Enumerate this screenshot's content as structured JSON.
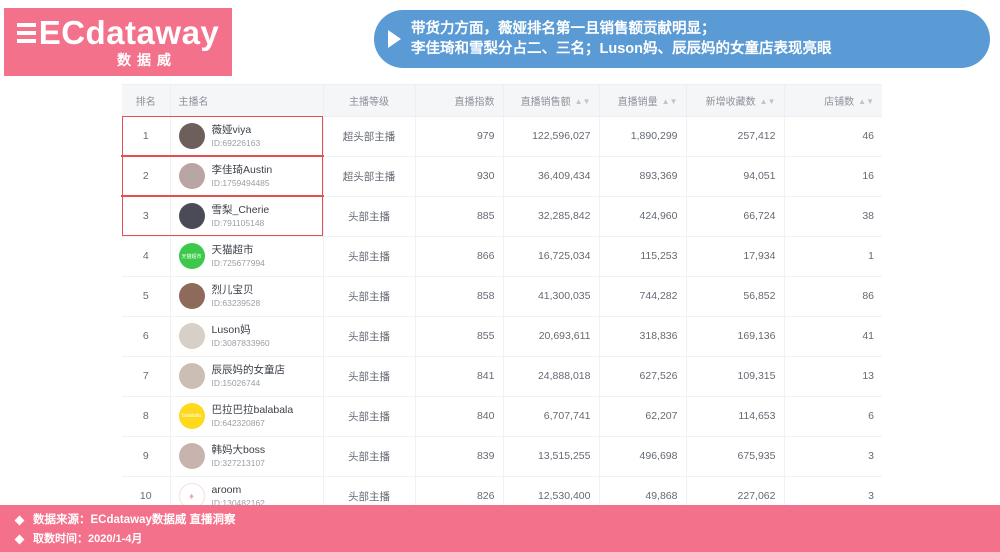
{
  "logo": {
    "name": "ECdataway",
    "sub": "数据威",
    "bars_icon": "three-bars-icon"
  },
  "banner": {
    "arrow_icon": "play-triangle-icon",
    "line1": "带货力方面，薇娅排名第一且销售额贡献明显；",
    "line2": "李佳琦和雪梨分占二、三名；Luson妈、辰辰妈的女童店表现亮眼",
    "color": "#5b9bd5"
  },
  "table": {
    "headers": {
      "rank": "排名",
      "name": "主播名",
      "level": "主播等级",
      "index": "直播指数",
      "sales": "直播销售额",
      "volume": "直播销量",
      "favorites": "新增收藏数",
      "shops": "店铺数"
    },
    "sort_icon": "sort-updown-icon",
    "id_prefix": "ID:",
    "highlight_color": "#e2504f",
    "rows": [
      {
        "rank": "1",
        "name": "薇娅viya",
        "id": "ID:69226163",
        "level": "超头部主播",
        "index": "979",
        "sales": "122,596,027",
        "volume": "1,890,299",
        "favorites": "257,412",
        "shops": "46",
        "avatar": "avatar-photo",
        "avatar_color": "#6e5f5c",
        "avatar_text": ""
      },
      {
        "rank": "2",
        "name": "李佳琦Austin",
        "id": "ID:1759494485",
        "level": "超头部主播",
        "index": "930",
        "sales": "36,409,434",
        "volume": "893,369",
        "favorites": "94,051",
        "shops": "16",
        "avatar": "avatar-photo",
        "avatar_color": "#b9a6a3",
        "avatar_text": ""
      },
      {
        "rank": "3",
        "name": "雪梨_Cherie",
        "id": "ID:791105148",
        "level": "头部主播",
        "index": "885",
        "sales": "32,285,842",
        "volume": "424,960",
        "favorites": "66,724",
        "shops": "38",
        "avatar": "avatar-photo",
        "avatar_color": "#4b4a57",
        "avatar_text": ""
      },
      {
        "rank": "4",
        "name": "天猫超市",
        "id": "ID:725677994",
        "level": "头部主播",
        "index": "866",
        "sales": "16,725,034",
        "volume": "115,253",
        "favorites": "17,934",
        "shops": "1",
        "avatar": "avatar-logo-tmall",
        "avatar_color": "#3cc84a",
        "avatar_text": "天猫超市"
      },
      {
        "rank": "5",
        "name": "烈儿宝贝",
        "id": "ID:63239528",
        "level": "头部主播",
        "index": "858",
        "sales": "41,300,035",
        "volume": "744,282",
        "favorites": "56,852",
        "shops": "86",
        "avatar": "avatar-photo",
        "avatar_color": "#8d6a5a",
        "avatar_text": ""
      },
      {
        "rank": "6",
        "name": "Luson妈",
        "id": "ID:3087833960",
        "level": "头部主播",
        "index": "855",
        "sales": "20,693,611",
        "volume": "318,836",
        "favorites": "169,136",
        "shops": "41",
        "avatar": "avatar-photo",
        "avatar_color": "#d8cfc6",
        "avatar_text": ""
      },
      {
        "rank": "7",
        "name": "辰辰妈的女童店",
        "id": "ID:15026744",
        "level": "头部主播",
        "index": "841",
        "sales": "24,888,018",
        "volume": "627,526",
        "favorites": "109,315",
        "shops": "13",
        "avatar": "avatar-photo",
        "avatar_color": "#cbbfb3",
        "avatar_text": ""
      },
      {
        "rank": "8",
        "name": "巴拉巴拉balabala",
        "id": "ID:642320867",
        "level": "头部主播",
        "index": "840",
        "sales": "6,707,741",
        "volume": "62,207",
        "favorites": "114,653",
        "shops": "6",
        "avatar": "avatar-logo-balabala",
        "avatar_color": "#ffd91c",
        "avatar_text": "balabala"
      },
      {
        "rank": "9",
        "name": "韩妈大boss",
        "id": "ID:327213107",
        "level": "头部主播",
        "index": "839",
        "sales": "13,515,255",
        "volume": "496,698",
        "favorites": "675,935",
        "shops": "3",
        "avatar": "avatar-photo",
        "avatar_color": "#c8b4ae",
        "avatar_text": ""
      },
      {
        "rank": "10",
        "name": "aroom",
        "id": "ID:130482162",
        "level": "头部主播",
        "index": "826",
        "sales": "12,530,400",
        "volume": "49,868",
        "favorites": "227,062",
        "shops": "3",
        "avatar": "avatar-logo-aroom",
        "avatar_color": "#ffffff",
        "avatar_text": ""
      }
    ]
  },
  "footer": {
    "bullet_icon": "diamond-bullet-icon",
    "source": "数据来源：ECdataway数据威 直播洞察",
    "time": "取数时间：2020/1-4月",
    "color": "#f4718b"
  }
}
